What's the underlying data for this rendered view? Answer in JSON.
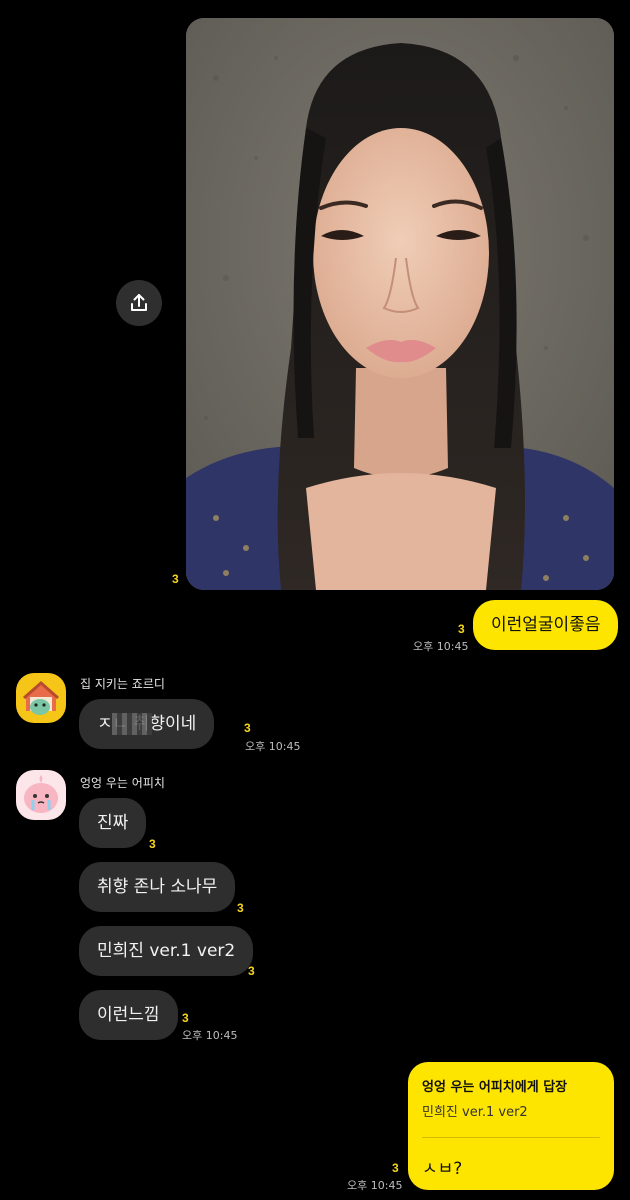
{
  "photo_message": {
    "unread": "3"
  },
  "messages_mine": [
    {
      "text": "이런얼굴이좋음",
      "unread": "3",
      "time": "오후 10:45"
    }
  ],
  "sender1": {
    "name": "집 지키는 죠르디",
    "messages": [
      {
        "text": "ㅈㄴ  취향이네",
        "unread": "3",
        "time": "오후 10:45"
      }
    ]
  },
  "sender2": {
    "name": "엉엉 우는 어피치",
    "messages": [
      {
        "text": "진짜",
        "unread": "3"
      },
      {
        "text": "취향 존나 소나무",
        "unread": "3"
      },
      {
        "text": "민희진 ver.1 ver2",
        "unread": "3"
      },
      {
        "text": "이런느낌",
        "unread": "3",
        "time": "오후 10:45"
      }
    ]
  },
  "reply": {
    "title": "엉엉 우는 어피치에게 답장",
    "quoted": "민희진 ver.1 ver2",
    "text": "ㅅㅂ?",
    "unread": "3",
    "time": "오후 10:45"
  },
  "colors": {
    "my_bubble": "#fee500",
    "other_bubble": "#2e2e2e",
    "unread": "#f7d51d",
    "background": "#000000"
  }
}
